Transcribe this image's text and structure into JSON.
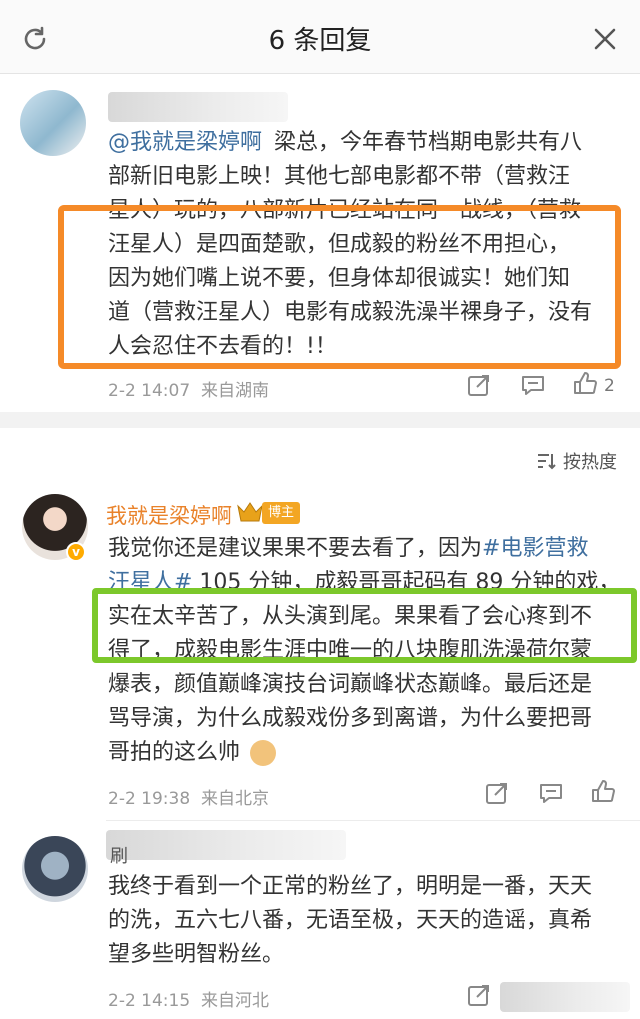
{
  "header": {
    "title": "6 条回复",
    "refresh_icon": "refresh-icon",
    "close_icon": "close-icon"
  },
  "main_comment": {
    "mention": "@我就是梁婷啊",
    "lines": [
      "梁总，今年春节档期电影共有八",
      "部新旧电影上映！其他七部电影都不带（营救汪",
      "星人）玩的，八部新片已经站在同一战线，（营救",
      "汪星人）是四面楚歌，但成毅的粉丝不用担心，",
      "因为她们嘴上说不要，但身体却很诚实！她们知",
      "道（营救汪星人）电影有成毅洗澡半裸身子，没有",
      "人会忍住不去看的！!！"
    ],
    "time": "2-2 14:07",
    "location": "来自湖南",
    "like_count": "2"
  },
  "sort": {
    "label": "按热度"
  },
  "reply1": {
    "name": "我就是梁婷啊",
    "badge": "博主",
    "line1": "我觉你还是建议果果不要去看了，因为",
    "hashtag": "#电影营救",
    "line2_tag": "汪星人#",
    "line2_rest": " 105 分钟，成毅哥哥起码有 89 分钟的戏，",
    "lines": [
      "实在太辛苦了，从头演到尾。果果看了会心疼到不",
      "得了，成毅电影生涯中唯一的八块腹肌洗澡荷尔蒙",
      "爆表，颜值巅峰演技台词巅峰状态巅峰。最后还是",
      "骂导演，为什么成毅戏份多到离谱，为什么要把哥",
      "哥拍的这么帅"
    ],
    "time": "2-2 19:38",
    "location": "来自北京"
  },
  "reply2": {
    "name_partial": "刷",
    "lines": [
      "我终于看到一个正常的粉丝了，明明是一番，天天",
      "的洗，五六七八番，无语至极，天天的造谣，真希",
      "望多些明智粉丝。"
    ],
    "time": "2-2 14:15",
    "location": "来自河北"
  },
  "colors": {
    "orange_highlight": "#f58a28",
    "green_highlight": "#7cc82b",
    "link_blue": "#3f6f9f",
    "owner_orange": "#e9822a"
  }
}
